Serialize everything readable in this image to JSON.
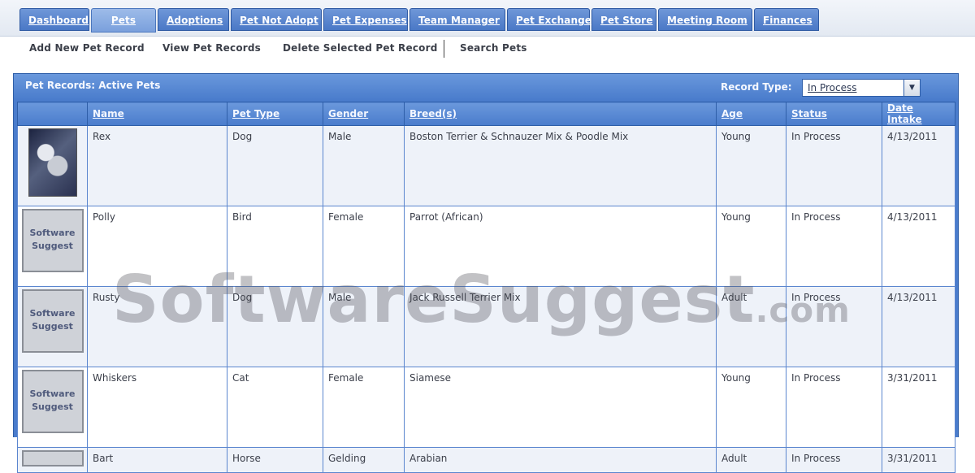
{
  "nav": {
    "tabs": [
      {
        "label": "Dashboard"
      },
      {
        "label": "Pets",
        "active": true
      },
      {
        "label": "Adoptions"
      },
      {
        "label": "Pet Not Adopt"
      },
      {
        "label": "Pet Expenses"
      },
      {
        "label": "Team Manager"
      },
      {
        "label": "Pet Exchange"
      },
      {
        "label": "Pet Store"
      },
      {
        "label": "Meeting Room"
      },
      {
        "label": "Finances"
      }
    ]
  },
  "subnav": {
    "add": "Add New Pet Record",
    "view": "View Pet Records",
    "delete": "Delete Selected Pet Record",
    "search": "Search Pets"
  },
  "panel": {
    "title": "Pet Records: Active Pets",
    "record_type_label": "Record Type:",
    "record_type_value": "In Process"
  },
  "table": {
    "headers": [
      "",
      "Name",
      "Pet Type",
      "Gender",
      "Breed(s)",
      "Age",
      "Status",
      "Date Intake"
    ],
    "placeholder_image_text": "Software Suggest",
    "rows": [
      {
        "name": "Rex",
        "type": "Dog",
        "gender": "Male",
        "breed": "Boston Terrier & Schnauzer Mix & Poodle Mix",
        "age": "Young",
        "status": "In Process",
        "date": "4/13/2011"
      },
      {
        "name": "Polly",
        "type": "Bird",
        "gender": "Female",
        "breed": "Parrot (African)",
        "age": "Young",
        "status": "In Process",
        "date": "4/13/2011"
      },
      {
        "name": "Rusty",
        "type": "Dog",
        "gender": "Male",
        "breed": "Jack Russell Terrier Mix",
        "age": "Adult",
        "status": "In Process",
        "date": "4/13/2011"
      },
      {
        "name": "Whiskers",
        "type": "Cat",
        "gender": "Female",
        "breed": "Siamese",
        "age": "Young",
        "status": "In Process",
        "date": "3/31/2011"
      },
      {
        "name": "Bart",
        "type": "Horse",
        "gender": "Gelding",
        "breed": "Arabian",
        "age": "Adult",
        "status": "In Process",
        "date": "3/31/2011"
      }
    ]
  },
  "watermark": {
    "main": "SoftwareSuggest",
    "suffix": ".com"
  },
  "colors": {
    "header_blue": "#4a7ccc",
    "tab_blue": "#4a78c6",
    "row_alt": "#eef2f9"
  }
}
